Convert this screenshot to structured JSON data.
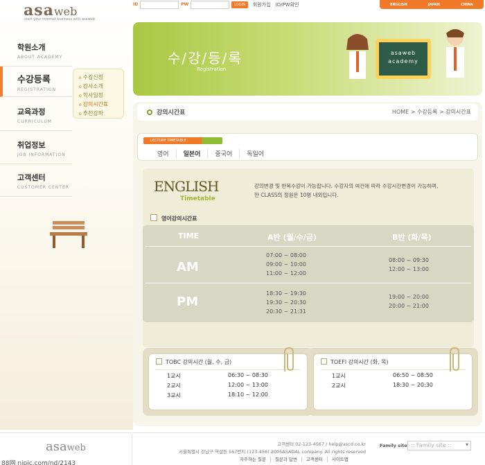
{
  "logo": {
    "asa": "asa",
    "web": "web",
    "tagline": "start your internet business with asaweb"
  },
  "login": {
    "id_label": "ID",
    "pw_label": "PW",
    "login_btn": "LOGIN",
    "join": "회원가입",
    "find": "ID/PW확인"
  },
  "langs": [
    "ENGLISH",
    "JAPAN",
    "CHINA"
  ],
  "menu": [
    {
      "ko": "학원소개",
      "en": "ABOUT ACADEMY"
    },
    {
      "ko": "수강등록",
      "en": "REGISTRATION"
    },
    {
      "ko": "교육과정",
      "en": "CURRICULUM"
    },
    {
      "ko": "취업정보",
      "en": "JOB INFORMATION"
    },
    {
      "ko": "고객센터",
      "en": "CUSTOMER CENTER"
    }
  ],
  "submenu": [
    "수강신청",
    "강사소개",
    "학사일정",
    "강의시간표",
    "추천강좌"
  ],
  "banner": {
    "title": "수/강/등/록",
    "sub": "Registration",
    "board1": "asaweb",
    "board2": "academy"
  },
  "header": {
    "title": "강의시간표",
    "breadcrumb": "HOME > 수강등록 > 강의시간표"
  },
  "tab_label": "LECTURE TIMETABLE",
  "tabs": [
    "영어",
    "일본어",
    "중국어",
    "독일어"
  ],
  "english": {
    "title": "ENGLISH",
    "sub": "Timetable",
    "desc1": "강의변경 및 반복수강이 가능합니다. 수강자의 여건에 따라 수강시간변경이 가능하며,",
    "desc2": "한 CLASS의 정원은 10명 내외입니다."
  },
  "section": "영어강의시간표",
  "table": {
    "h_time": "TIME",
    "h_a": "A반 (월/수/금)",
    "h_b": "B반 (화/목)",
    "am": "AM",
    "pm": "PM",
    "am_a": [
      "07:00 ~ 08:00",
      "09:00 ~ 10:00",
      "11:00 ~ 12:00"
    ],
    "am_b": [
      "08:00 ~ 09:30",
      "12:00 ~ 13:00"
    ],
    "pm_a": [
      "18:30 ~ 19:30",
      "19:30 ~ 20:30",
      "20:30 ~ 21:31"
    ],
    "pm_b": [
      "19:00 ~ 20:00",
      "20:00 ~ 21:00"
    ]
  },
  "toeic": {
    "title": "TOBC 강의시간 (월, 수, 금)",
    "rows": [
      [
        "1교시",
        "06:30 ~ 08:30"
      ],
      [
        "2교시",
        "12:00 ~ 13:00"
      ],
      [
        "3교시",
        "18:10 ~ 12:00"
      ]
    ]
  },
  "toefl": {
    "title": "TOEFl 강의시간 (화, 목)",
    "rows": [
      [
        "1교시",
        "06:50 ~ 08:50"
      ],
      [
        "2교시",
        "18:30 ~ 20:30"
      ]
    ]
  },
  "footer": {
    "logo_a": "asa",
    "logo_w": "web",
    "line1": "고객센터 02-123-4567 / help@ascd.co.kr",
    "line2": "서울특별시 강남구 역삼동 567번지 (123-456) 2005ASADAL company. All rights reserved",
    "links": [
      "자주하는 질문",
      "질문과 답변",
      "고객센터",
      "사이트맵"
    ],
    "family_label": "Family site",
    "family_placeholder": ":: Family site ::"
  },
  "watermark": "88网 nipic.com/nd/2143"
}
